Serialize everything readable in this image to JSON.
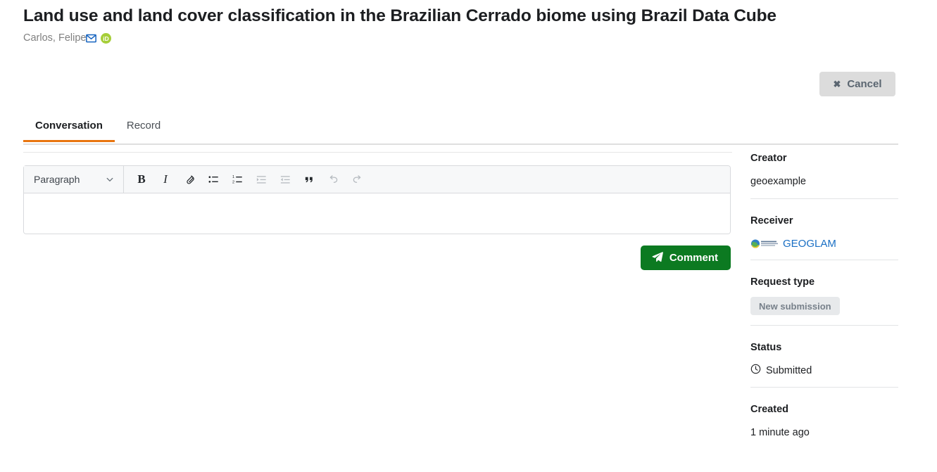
{
  "header": {
    "title": "Land use and land cover classification in the Brazilian Cerrado biome using Brazil Data Cube",
    "creator_name": "Carlos, Felipe",
    "mail_icon": "envelope-icon",
    "orcid_icon": "orcid-icon",
    "orcid_text": "iD"
  },
  "actions": {
    "cancel_label": "Cancel",
    "cancel_icon": "close-x-icon"
  },
  "tabs": [
    {
      "label": "Conversation",
      "active": true
    },
    {
      "label": "Record",
      "active": false
    }
  ],
  "editor": {
    "block_format": "Paragraph",
    "content": "",
    "toolbar": [
      {
        "name": "bold-icon",
        "label": "B",
        "disabled": false
      },
      {
        "name": "italic-icon",
        "label": "I",
        "disabled": false
      },
      {
        "name": "link-icon",
        "label": "",
        "disabled": false
      },
      {
        "name": "bulleted-list-icon",
        "label": "",
        "disabled": false
      },
      {
        "name": "numbered-list-icon",
        "label": "",
        "disabled": false
      },
      {
        "name": "outdent-icon",
        "label": "",
        "disabled": true
      },
      {
        "name": "indent-icon",
        "label": "",
        "disabled": true
      },
      {
        "name": "blockquote-icon",
        "label": "“",
        "disabled": false
      },
      {
        "name": "undo-icon",
        "label": "",
        "disabled": true
      },
      {
        "name": "redo-icon",
        "label": "",
        "disabled": true
      }
    ]
  },
  "comment": {
    "label": "Comment",
    "icon": "send-paper-plane-icon"
  },
  "sidebar": {
    "creator": {
      "label": "Creator",
      "value": "geoexample"
    },
    "receiver": {
      "label": "Receiver",
      "value": "GEOGLAM",
      "logo": "geoglam-globe-logo"
    },
    "request_type": {
      "label": "Request type",
      "value": "New submission"
    },
    "status": {
      "label": "Status",
      "value": "Submitted",
      "icon": "clock-icon"
    },
    "created": {
      "label": "Created",
      "value": "1 minute ago"
    }
  },
  "colors": {
    "accent_orange": "#e8750f",
    "comment_green": "#0c7a21",
    "link_blue": "#1a6fc4",
    "cancel_gray": "#dcdcdc",
    "badge_gray": "#e7e9eb"
  }
}
